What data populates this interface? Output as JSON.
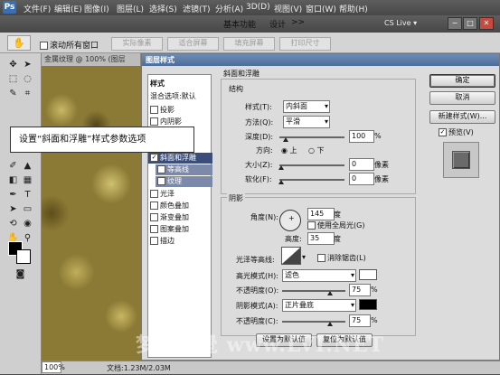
{
  "app": {
    "logo": "Ps"
  },
  "menu": [
    "文件(F)",
    "编辑(E)",
    "图像(I)",
    "图层(L)",
    "选择(S)",
    "滤镜(T)",
    "分析(A)",
    "3D(D)",
    "视图(V)",
    "窗口(W)",
    "帮助(H)"
  ],
  "workspace": {
    "active": "基本功能",
    "design": "设计",
    "more": ">>"
  },
  "cs_live": "CS Live ▾",
  "window_buttons": {
    "minimize": "−",
    "maximize": "□",
    "close": "✕"
  },
  "options": {
    "scroll_all_label": "滚动所有窗口",
    "buttons": [
      "实际像素",
      "适合屏幕",
      "填充屏幕",
      "打印尺寸"
    ]
  },
  "document": {
    "tab": "金属纹理 @ 100% (图层",
    "zoom": "100%",
    "doc_size": "文档:1.23M/2.03M"
  },
  "dialog": {
    "title": "图层样式",
    "styles_header": "样式",
    "blend_options": "混合选项:默认",
    "styles": [
      {
        "label": "投影",
        "checked": false
      },
      {
        "label": "内阴影",
        "checked": false
      },
      {
        "label": "外发光",
        "checked": false
      },
      {
        "label": "内发光",
        "checked": false
      },
      {
        "label": "斜面和浮雕",
        "checked": true,
        "selected": true
      },
      {
        "label": "等高线",
        "checked": false,
        "sub": true
      },
      {
        "label": "纹理",
        "checked": false,
        "sub": true
      },
      {
        "label": "光泽",
        "checked": false
      },
      {
        "label": "颜色叠加",
        "checked": false
      },
      {
        "label": "渐变叠加",
        "checked": false
      },
      {
        "label": "图案叠加",
        "checked": false
      },
      {
        "label": "描边",
        "checked": false
      }
    ],
    "bevel": {
      "section": "斜面和浮雕",
      "structure": "结构",
      "style_label": "样式(T):",
      "style_value": "内斜面",
      "method_label": "方法(Q):",
      "method_value": "平滑",
      "depth_label": "深度(D):",
      "depth_value": "100",
      "depth_unit": "%",
      "depth_level": 0.1,
      "direction_label": "方向:",
      "direction_up": "上",
      "direction_down": "下",
      "size_label": "大小(Z):",
      "size_value": "0",
      "size_unit": "像素",
      "soften_label": "软化(F):",
      "soften_value": "0",
      "soften_unit": "像素"
    },
    "shading": {
      "section": "阴影",
      "angle_label": "角度(N):",
      "angle_value": "145",
      "angle_unit": "度",
      "global_light": "使用全局光(G)",
      "altitude_label": "高度:",
      "altitude_value": "35",
      "altitude_unit": "度",
      "contour_label": "光泽等高线:",
      "antialias": "消除锯齿(L)",
      "highlight_label": "高光模式(H):",
      "highlight_mode": "滤色",
      "highlight_color": "#ffffff",
      "highlight_opacity_label": "不透明度(O):",
      "highlight_opacity": "75",
      "highlight_opacity_unit": "%",
      "shadow_label": "阴影模式(A):",
      "shadow_mode": "正片叠底",
      "shadow_color": "#000000",
      "shadow_opacity_label": "不透明度(C):",
      "shadow_opacity": "75",
      "shadow_opacity_unit": "%"
    },
    "make_default": "设置为默认值",
    "reset_default": "复位为默认值",
    "ok": "确定",
    "cancel": "取消",
    "new_style": "新建样式(W)...",
    "preview": "预览(V)"
  },
  "callout": "设置“斜面和浮雕”样式参数选项",
  "watermark": "梦龍視覺 www.LVI.NET"
}
